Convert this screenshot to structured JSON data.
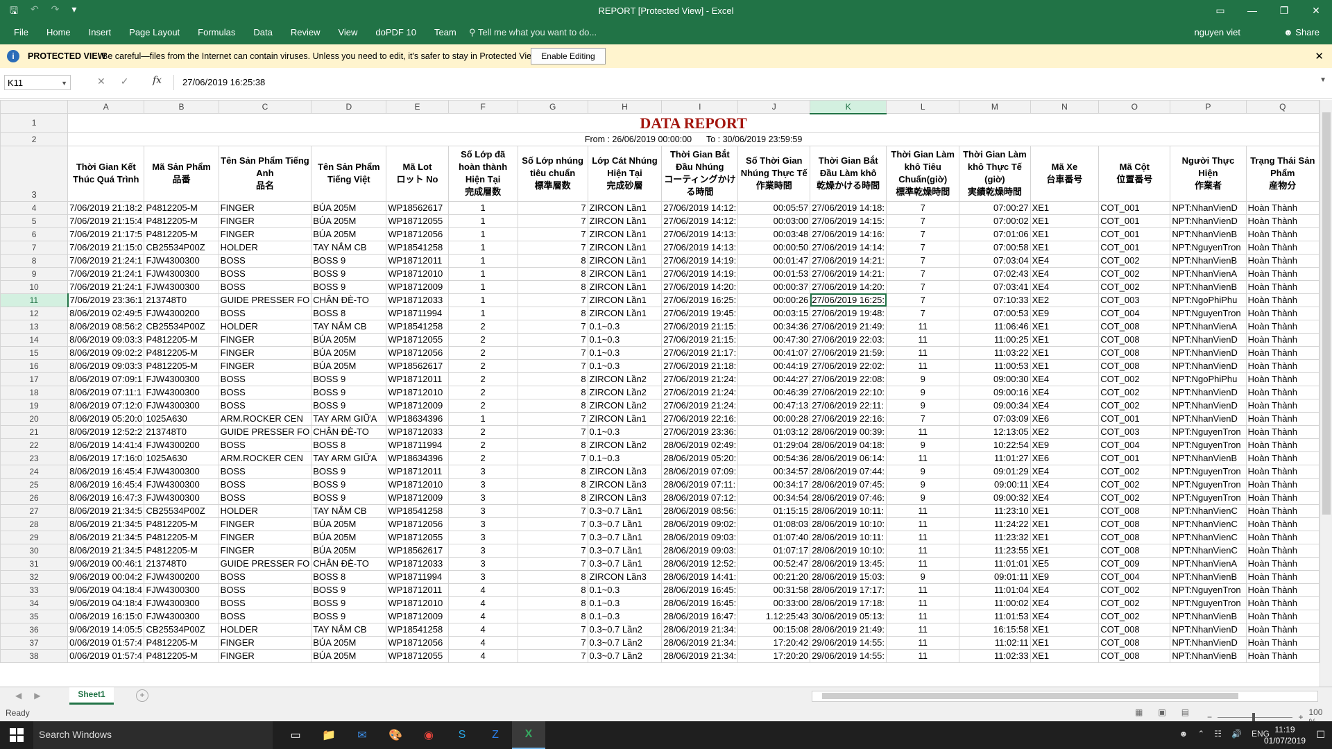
{
  "window": {
    "title": "REPORT  [Protected View] - Excel"
  },
  "ribbon": {
    "tabs": [
      "File",
      "Home",
      "Insert",
      "Page Layout",
      "Formulas",
      "Data",
      "Review",
      "View",
      "doPDF 10",
      "Team"
    ],
    "tell_me": "Tell me what you want to do...",
    "user": "nguyen viet",
    "share": "Share"
  },
  "protected": {
    "title": "PROTECTED VIEW",
    "message": "Be careful—files from the Internet can contain viruses. Unless you need to edit, it's safer to stay in Protected View.",
    "enable_button": "Enable Editing"
  },
  "formula_bar": {
    "name_box": "K11",
    "fx": "fx",
    "value": "27/06/2019 16:25:38"
  },
  "columns": [
    "A",
    "B",
    "C",
    "D",
    "E",
    "F",
    "G",
    "H",
    "I",
    "J",
    "K",
    "L",
    "M",
    "N",
    "O",
    "P",
    "Q"
  ],
  "sheet": {
    "title": "DATA REPORT",
    "range_from": "From : 26/06/2019 00:00:00",
    "range_to": "To : 30/06/2019 23:59:59",
    "headers": [
      [
        "Thời Gian Kết Thúc Quá Trình",
        ""
      ],
      [
        "Mã Sản Phẩm",
        "品番"
      ],
      [
        "Tên Sản Phẩm Tiếng Anh",
        "品名"
      ],
      [
        "Tên Sản Phẩm Tiếng Việt",
        ""
      ],
      [
        "Mã Lot",
        "ロット No"
      ],
      [
        "Số Lớp đã hoàn thành Hiện Tại",
        "完成層数"
      ],
      [
        "Số Lớp nhúng tiêu chuẩn",
        "標準層数"
      ],
      [
        "Lớp Cát Nhúng Hiện Tại",
        "完成砂層"
      ],
      [
        "Thời Gian Bắt Đầu Nhúng",
        "コーティングかける時間"
      ],
      [
        "Số Thời Gian Nhúng Thực Tế",
        "作業時間"
      ],
      [
        "Thời Gian Bắt Đầu Làm khô",
        "乾燥かける時間"
      ],
      [
        "Thời Gian Làm khô Tiêu Chuẩn(giờ)",
        "標準乾燥時間"
      ],
      [
        "Thời Gian Làm khô Thực Tế (giờ)",
        "実績乾燥時間"
      ],
      [
        "Mã Xe",
        "台車番号"
      ],
      [
        "Mã Cột",
        "位置番号"
      ],
      [
        "Người Thực Hiện",
        "作業者"
      ],
      [
        "Trạng Thái Sản Phẩm",
        "産物分"
      ]
    ],
    "rows": [
      [
        "7/06/2019 21:18:2",
        "P4812205-M",
        "FINGER",
        "BÚA 205M",
        "WP18562617",
        "1",
        "7",
        "ZIRCON Lần1",
        "27/06/2019 14:12:",
        "00:05:57",
        "27/06/2019 14:18:",
        "7",
        "07:00:27",
        "XE1",
        "COT_001",
        "NPT:NhanVienD",
        "Hoàn Thành"
      ],
      [
        "7/06/2019 21:15:4",
        "P4812205-M",
        "FINGER",
        "BÚA 205M",
        "WP18712055",
        "1",
        "7",
        "ZIRCON Lần1",
        "27/06/2019 14:12:",
        "00:03:00",
        "27/06/2019 14:15:",
        "7",
        "07:00:02",
        "XE1",
        "COT_001",
        "NPT:NhanVienD",
        "Hoàn Thành"
      ],
      [
        "7/06/2019 21:17:5",
        "P4812205-M",
        "FINGER",
        "BÚA 205M",
        "WP18712056",
        "1",
        "7",
        "ZIRCON Lần1",
        "27/06/2019 14:13:",
        "00:03:48",
        "27/06/2019 14:16:",
        "7",
        "07:01:06",
        "XE1",
        "COT_001",
        "NPT:NhanVienB",
        "Hoàn Thành"
      ],
      [
        "7/06/2019 21:15:0",
        "CB25534P00Z",
        "HOLDER",
        "TAY NẮM CB",
        "WP18541258",
        "1",
        "7",
        "ZIRCON Lần1",
        "27/06/2019 14:13:",
        "00:00:50",
        "27/06/2019 14:14:",
        "7",
        "07:00:58",
        "XE1",
        "COT_001",
        "NPT:NguyenTron",
        "Hoàn Thành"
      ],
      [
        "7/06/2019 21:24:1",
        "FJW4300300",
        "BOSS",
        "BOSS 9",
        "WP18712011",
        "1",
        "8",
        "ZIRCON Lần1",
        "27/06/2019 14:19:",
        "00:01:47",
        "27/06/2019 14:21:",
        "7",
        "07:03:04",
        "XE4",
        "COT_002",
        "NPT:NhanVienB",
        "Hoàn Thành"
      ],
      [
        "7/06/2019 21:24:1",
        "FJW4300300",
        "BOSS",
        "BOSS 9",
        "WP18712010",
        "1",
        "8",
        "ZIRCON Lần1",
        "27/06/2019 14:19:",
        "00:01:53",
        "27/06/2019 14:21:",
        "7",
        "07:02:43",
        "XE4",
        "COT_002",
        "NPT:NhanVienA",
        "Hoàn Thành"
      ],
      [
        "7/06/2019 21:24:1",
        "FJW4300300",
        "BOSS",
        "BOSS 9",
        "WP18712009",
        "1",
        "8",
        "ZIRCON Lần1",
        "27/06/2019 14:20:",
        "00:00:37",
        "27/06/2019 14:20:",
        "7",
        "07:03:41",
        "XE4",
        "COT_002",
        "NPT:NhanVienB",
        "Hoàn Thành"
      ],
      [
        "7/06/2019 23:36:1",
        "213748T0",
        "GUIDE PRESSER FO",
        "CHÂN ĐÈ-TO",
        "WP18712033",
        "1",
        "7",
        "ZIRCON Lần1",
        "27/06/2019 16:25:",
        "00:00:26",
        "27/06/2019 16:25:",
        "7",
        "07:10:33",
        "XE2",
        "COT_003",
        "NPT:NgoPhiPhu",
        "Hoàn Thành"
      ],
      [
        "8/06/2019 02:49:5",
        "FJW4300200",
        "BOSS",
        "BOSS 8",
        "WP18711994",
        "1",
        "8",
        "ZIRCON Lần1",
        "27/06/2019 19:45:",
        "00:03:15",
        "27/06/2019 19:48:",
        "7",
        "07:00:53",
        "XE9",
        "COT_004",
        "NPT:NguyenTron",
        "Hoàn Thành"
      ],
      [
        "8/06/2019 08:56:2",
        "CB25534P00Z",
        "HOLDER",
        "TAY NẮM CB",
        "WP18541258",
        "2",
        "7",
        "0.1~0.3",
        "27/06/2019 21:15:",
        "00:34:36",
        "27/06/2019 21:49:",
        "11",
        "11:06:46",
        "XE1",
        "COT_008",
        "NPT:NhanVienA",
        "Hoàn Thành"
      ],
      [
        "8/06/2019 09:03:3",
        "P4812205-M",
        "FINGER",
        "BÚA 205M",
        "WP18712055",
        "2",
        "7",
        "0.1~0.3",
        "27/06/2019 21:15:",
        "00:47:30",
        "27/06/2019 22:03:",
        "11",
        "11:00:25",
        "XE1",
        "COT_008",
        "NPT:NhanVienD",
        "Hoàn Thành"
      ],
      [
        "8/06/2019 09:02:2",
        "P4812205-M",
        "FINGER",
        "BÚA 205M",
        "WP18712056",
        "2",
        "7",
        "0.1~0.3",
        "27/06/2019 21:17:",
        "00:41:07",
        "27/06/2019 21:59:",
        "11",
        "11:03:22",
        "XE1",
        "COT_008",
        "NPT:NhanVienD",
        "Hoàn Thành"
      ],
      [
        "8/06/2019 09:03:3",
        "P4812205-M",
        "FINGER",
        "BÚA 205M",
        "WP18562617",
        "2",
        "7",
        "0.1~0.3",
        "27/06/2019 21:18:",
        "00:44:19",
        "27/06/2019 22:02:",
        "11",
        "11:00:53",
        "XE1",
        "COT_008",
        "NPT:NhanVienD",
        "Hoàn Thành"
      ],
      [
        "8/06/2019 07:09:1",
        "FJW4300300",
        "BOSS",
        "BOSS 9",
        "WP18712011",
        "2",
        "8",
        "ZIRCON Lần2",
        "27/06/2019 21:24:",
        "00:44:27",
        "27/06/2019 22:08:",
        "9",
        "09:00:30",
        "XE4",
        "COT_002",
        "NPT:NgoPhiPhu",
        "Hoàn Thành"
      ],
      [
        "8/06/2019 07:11:1",
        "FJW4300300",
        "BOSS",
        "BOSS 9",
        "WP18712010",
        "2",
        "8",
        "ZIRCON Lần2",
        "27/06/2019 21:24:",
        "00:46:39",
        "27/06/2019 22:10:",
        "9",
        "09:00:16",
        "XE4",
        "COT_002",
        "NPT:NhanVienD",
        "Hoàn Thành"
      ],
      [
        "8/06/2019 07:12:0",
        "FJW4300300",
        "BOSS",
        "BOSS 9",
        "WP18712009",
        "2",
        "8",
        "ZIRCON Lần2",
        "27/06/2019 21:24:",
        "00:47:13",
        "27/06/2019 22:11:",
        "9",
        "09:00:34",
        "XE4",
        "COT_002",
        "NPT:NhanVienD",
        "Hoàn Thành"
      ],
      [
        "8/06/2019 05:20:0",
        "1025A630",
        "ARM.ROCKER CEN",
        "TAY ARM GIỮA",
        "WP18634396",
        "1",
        "7",
        "ZIRCON Lần1",
        "27/06/2019 22:16:",
        "00:00:28",
        "27/06/2019 22:16:",
        "7",
        "07:03:09",
        "XE6",
        "COT_001",
        "NPT:NhanVienD",
        "Hoàn Thành"
      ],
      [
        "8/06/2019 12:52:2",
        "213748T0",
        "GUIDE PRESSER FO",
        "CHÂN ĐÈ-TO",
        "WP18712033",
        "2",
        "7",
        "0.1~0.3",
        "27/06/2019 23:36:",
        "01:03:12",
        "28/06/2019 00:39:",
        "11",
        "12:13:05",
        "XE2",
        "COT_003",
        "NPT:NguyenTron",
        "Hoàn Thành"
      ],
      [
        "8/06/2019 14:41:4",
        "FJW4300200",
        "BOSS",
        "BOSS 8",
        "WP18711994",
        "2",
        "8",
        "ZIRCON Lần2",
        "28/06/2019 02:49:",
        "01:29:04",
        "28/06/2019 04:18:",
        "9",
        "10:22:54",
        "XE9",
        "COT_004",
        "NPT:NguyenTron",
        "Hoàn Thành"
      ],
      [
        "8/06/2019 17:16:0",
        "1025A630",
        "ARM.ROCKER CEN",
        "TAY ARM GIỮA",
        "WP18634396",
        "2",
        "7",
        "0.1~0.3",
        "28/06/2019 05:20:",
        "00:54:36",
        "28/06/2019 06:14:",
        "11",
        "11:01:27",
        "XE6",
        "COT_001",
        "NPT:NhanVienB",
        "Hoàn Thành"
      ],
      [
        "8/06/2019 16:45:4",
        "FJW4300300",
        "BOSS",
        "BOSS 9",
        "WP18712011",
        "3",
        "8",
        "ZIRCON Lần3",
        "28/06/2019 07:09:",
        "00:34:57",
        "28/06/2019 07:44:",
        "9",
        "09:01:29",
        "XE4",
        "COT_002",
        "NPT:NguyenTron",
        "Hoàn Thành"
      ],
      [
        "8/06/2019 16:45:4",
        "FJW4300300",
        "BOSS",
        "BOSS 9",
        "WP18712010",
        "3",
        "8",
        "ZIRCON Lần3",
        "28/06/2019 07:11:",
        "00:34:17",
        "28/06/2019 07:45:",
        "9",
        "09:00:11",
        "XE4",
        "COT_002",
        "NPT:NguyenTron",
        "Hoàn Thành"
      ],
      [
        "8/06/2019 16:47:3",
        "FJW4300300",
        "BOSS",
        "BOSS 9",
        "WP18712009",
        "3",
        "8",
        "ZIRCON Lần3",
        "28/06/2019 07:12:",
        "00:34:54",
        "28/06/2019 07:46:",
        "9",
        "09:00:32",
        "XE4",
        "COT_002",
        "NPT:NguyenTron",
        "Hoàn Thành"
      ],
      [
        "8/06/2019 21:34:5",
        "CB25534P00Z",
        "HOLDER",
        "TAY NẮM CB",
        "WP18541258",
        "3",
        "7",
        "0.3~0.7 Lần1",
        "28/06/2019 08:56:",
        "01:15:15",
        "28/06/2019 10:11:",
        "11",
        "11:23:10",
        "XE1",
        "COT_008",
        "NPT:NhanVienC",
        "Hoàn Thành"
      ],
      [
        "8/06/2019 21:34:5",
        "P4812205-M",
        "FINGER",
        "BÚA 205M",
        "WP18712056",
        "3",
        "7",
        "0.3~0.7 Lần1",
        "28/06/2019 09:02:",
        "01:08:03",
        "28/06/2019 10:10:",
        "11",
        "11:24:22",
        "XE1",
        "COT_008",
        "NPT:NhanVienC",
        "Hoàn Thành"
      ],
      [
        "8/06/2019 21:34:5",
        "P4812205-M",
        "FINGER",
        "BÚA 205M",
        "WP18712055",
        "3",
        "7",
        "0.3~0.7 Lần1",
        "28/06/2019 09:03:",
        "01:07:40",
        "28/06/2019 10:11:",
        "11",
        "11:23:32",
        "XE1",
        "COT_008",
        "NPT:NhanVienC",
        "Hoàn Thành"
      ],
      [
        "8/06/2019 21:34:5",
        "P4812205-M",
        "FINGER",
        "BÚA 205M",
        "WP18562617",
        "3",
        "7",
        "0.3~0.7 Lần1",
        "28/06/2019 09:03:",
        "01:07:17",
        "28/06/2019 10:10:",
        "11",
        "11:23:55",
        "XE1",
        "COT_008",
        "NPT:NhanVienC",
        "Hoàn Thành"
      ],
      [
        "9/06/2019 00:46:1",
        "213748T0",
        "GUIDE PRESSER FO",
        "CHÂN ĐÈ-TO",
        "WP18712033",
        "3",
        "7",
        "0.3~0.7 Lần1",
        "28/06/2019 12:52:",
        "00:52:47",
        "28/06/2019 13:45:",
        "11",
        "11:01:01",
        "XE5",
        "COT_009",
        "NPT:NhanVienA",
        "Hoàn Thành"
      ],
      [
        "9/06/2019 00:04:2",
        "FJW4300200",
        "BOSS",
        "BOSS 8",
        "WP18711994",
        "3",
        "8",
        "ZIRCON Lần3",
        "28/06/2019 14:41:",
        "00:21:20",
        "28/06/2019 15:03:",
        "9",
        "09:01:11",
        "XE9",
        "COT_004",
        "NPT:NhanVienB",
        "Hoàn Thành"
      ],
      [
        "9/06/2019 04:18:4",
        "FJW4300300",
        "BOSS",
        "BOSS 9",
        "WP18712011",
        "4",
        "8",
        "0.1~0.3",
        "28/06/2019 16:45:",
        "00:31:58",
        "28/06/2019 17:17:",
        "11",
        "11:01:04",
        "XE4",
        "COT_002",
        "NPT:NguyenTron",
        "Hoàn Thành"
      ],
      [
        "9/06/2019 04:18:4",
        "FJW4300300",
        "BOSS",
        "BOSS 9",
        "WP18712010",
        "4",
        "8",
        "0.1~0.3",
        "28/06/2019 16:45:",
        "00:33:00",
        "28/06/2019 17:18:",
        "11",
        "11:00:02",
        "XE4",
        "COT_002",
        "NPT:NguyenTron",
        "Hoàn Thành"
      ],
      [
        "0/06/2019 16:15:0",
        "FJW4300300",
        "BOSS",
        "BOSS 9",
        "WP18712009",
        "4",
        "8",
        "0.1~0.3",
        "28/06/2019 16:47:",
        "1.12:25:43",
        "30/06/2019 05:13:",
        "11",
        "11:01:53",
        "XE4",
        "COT_002",
        "NPT:NhanVienB",
        "Hoàn Thành"
      ],
      [
        "9/06/2019 14:05:5",
        "CB25534P00Z",
        "HOLDER",
        "TAY NẮM CB",
        "WP18541258",
        "4",
        "7",
        "0.3~0.7 Lần2",
        "28/06/2019 21:34:",
        "00:15:08",
        "28/06/2019 21:49:",
        "11",
        "16:15:58",
        "XE1",
        "COT_008",
        "NPT:NhanVienD",
        "Hoàn Thành"
      ],
      [
        "0/06/2019 01:57:4",
        "P4812205-M",
        "FINGER",
        "BÚA 205M",
        "WP18712056",
        "4",
        "7",
        "0.3~0.7 Lần2",
        "28/06/2019 21:34:",
        "17:20:42",
        "29/06/2019 14:55:",
        "11",
        "11:02:11",
        "XE1",
        "COT_008",
        "NPT:NhanVienD",
        "Hoàn Thành"
      ],
      [
        "0/06/2019 01:57:4",
        "P4812205-M",
        "FINGER",
        "BÚA 205M",
        "WP18712055",
        "4",
        "7",
        "0.3~0.7 Lần2",
        "28/06/2019 21:34:",
        "17:20:20",
        "29/06/2019 14:55:",
        "11",
        "11:02:33",
        "XE1",
        "COT_008",
        "NPT:NhanVienB",
        "Hoàn Thành"
      ]
    ]
  },
  "sheet_tabs": [
    "Sheet1"
  ],
  "status": {
    "ready": "Ready",
    "zoom": "100 %"
  },
  "taskbar": {
    "search": "Search Windows",
    "lang": "ENG",
    "time": "11:19",
    "date": "01/07/2019"
  }
}
